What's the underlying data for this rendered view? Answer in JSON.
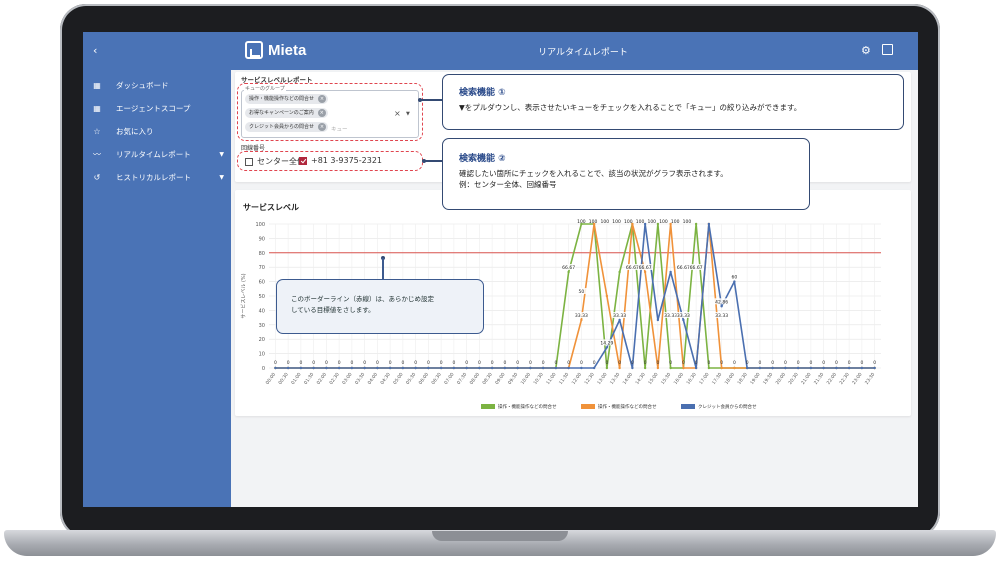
{
  "app": {
    "brand": "Mieta",
    "page_title": "リアルタイムレポート",
    "collapse_glyph": "‹"
  },
  "sidebar": {
    "items": [
      {
        "label": "ダッシュボード",
        "icon": "dashboard-icon",
        "expandable": false
      },
      {
        "label": "エージェントスコープ",
        "icon": "agent-scope-icon",
        "expandable": false
      },
      {
        "label": "お気に入り",
        "icon": "star-icon",
        "expandable": false
      },
      {
        "label": "リアルタイムレポート",
        "icon": "trend-icon",
        "expandable": true
      },
      {
        "label": "ヒストリカルレポート",
        "icon": "history-icon",
        "expandable": true
      }
    ]
  },
  "filter": {
    "section_title": "サービスレベルレポート",
    "queue_label": "キューのグループ",
    "queue_chips": [
      "操作・機能操作などの問合せ",
      "お得なキャンペーンのご案内",
      "クレジット会員からの問合せ"
    ],
    "queue_placeholder": "キュー",
    "line_label": "回線番号",
    "checkboxes": [
      {
        "label": "センター全体",
        "checked": false
      },
      {
        "label": "+81 3-9375-2321",
        "checked": true
      }
    ]
  },
  "callouts": {
    "search1": {
      "title": "検索機能 ①",
      "text": "▼をプルダウンし、表示させたいキューをチェックを入れることで「キュー」の絞り込みができます。"
    },
    "search2": {
      "title": "検索機能 ②",
      "line1": "確認したい箇所にチェックを入れることで、該当の状況がグラフ表示されます。",
      "line2": "例：センター全体、回線番号"
    },
    "border": {
      "line1": "このボーダーライン（赤線）は、あらかじめ設定",
      "line2": "している目標値をさします。"
    }
  },
  "colors": {
    "brand_blue": "#4a73b6",
    "green": "#7cb342",
    "orange": "#f0923a",
    "blue": "#4a6fb0",
    "target_line": "#d9534f"
  },
  "chart_data": {
    "type": "line",
    "title": "サービスレベル",
    "ylabel": "サービスレベル (%)",
    "ylim": [
      0,
      100
    ],
    "yticks": [
      0,
      10,
      20,
      30,
      40,
      50,
      60,
      70,
      80,
      90,
      100
    ],
    "target": 80,
    "grid": true,
    "legend_position": "bottom",
    "x": [
      "00:00",
      "00:30",
      "01:00",
      "01:30",
      "02:00",
      "02:30",
      "03:00",
      "03:30",
      "04:00",
      "04:30",
      "05:00",
      "05:30",
      "06:00",
      "06:30",
      "07:00",
      "07:30",
      "08:00",
      "08:30",
      "09:00",
      "09:30",
      "10:00",
      "10:30",
      "11:00",
      "11:30",
      "12:00",
      "12:30",
      "13:00",
      "13:30",
      "14:00",
      "14:30",
      "15:00",
      "15:30",
      "16:00",
      "16:30",
      "17:00",
      "17:30",
      "18:00",
      "18:30",
      "19:00",
      "19:30",
      "20:00",
      "20:30",
      "21:00",
      "21:30",
      "22:00",
      "22:30",
      "23:00",
      "23:30"
    ],
    "series": [
      {
        "name": "操作・機能操作などの問合せ",
        "color": "#7cb342",
        "values": [
          0,
          0,
          0,
          0,
          0,
          0,
          0,
          0,
          0,
          0,
          0,
          0,
          0,
          0,
          0,
          0,
          0,
          0,
          0,
          0,
          0,
          0,
          0,
          66.67,
          100,
          100,
          0,
          66.67,
          100,
          0,
          100,
          0,
          0,
          100,
          0,
          0,
          0,
          0,
          0,
          0,
          0,
          0,
          0,
          0,
          0,
          0,
          0,
          0
        ]
      },
      {
        "name": "操作・機能操作などの問合せ",
        "color": "#f0923a",
        "values": [
          0,
          0,
          0,
          0,
          0,
          0,
          0,
          0,
          0,
          0,
          0,
          0,
          0,
          0,
          0,
          0,
          0,
          0,
          0,
          0,
          0,
          0,
          0,
          0,
          33.33,
          100,
          50,
          0,
          100,
          66.67,
          0,
          100,
          0,
          0,
          100,
          0,
          0,
          0,
          0,
          0,
          0,
          0,
          0,
          0,
          0,
          0,
          0,
          0
        ]
      },
      {
        "name": "クレジット会員からの問合せ",
        "color": "#4a6fb0",
        "values": [
          0,
          0,
          0,
          0,
          0,
          0,
          0,
          0,
          0,
          0,
          0,
          0,
          0,
          0,
          0,
          0,
          0,
          0,
          0,
          0,
          0,
          0,
          0,
          0,
          0,
          0,
          14.29,
          33.33,
          0,
          100,
          33.33,
          66.67,
          33.33,
          0,
          100,
          42.86,
          60,
          0,
          0,
          0,
          0,
          0,
          0,
          0,
          0,
          0,
          0,
          0
        ]
      }
    ],
    "data_labels": [
      {
        "x": "11:30",
        "text": "66.67"
      },
      {
        "x": "12:00",
        "text": "50"
      },
      {
        "x": "12:00",
        "text": "33.33"
      },
      {
        "x": "13:00",
        "text": "14.29"
      },
      {
        "x": "13:30",
        "text": "33.33"
      },
      {
        "x": "14:00",
        "text": "66.67"
      },
      {
        "x": "14:30",
        "text": "66.67"
      },
      {
        "x": "15:30",
        "text": "33.33"
      },
      {
        "x": "16:00",
        "text": "66.67"
      },
      {
        "x": "16:00",
        "text": "33.33"
      },
      {
        "x": "16:30",
        "text": "66.67"
      },
      {
        "x": "17:30",
        "text": "42.86"
      },
      {
        "x": "17:30",
        "text": "33.33"
      },
      {
        "x": "18:00",
        "text": "60"
      }
    ],
    "top_labels": [
      "100",
      "100",
      "100",
      "100",
      "100",
      "100",
      "100",
      "100",
      "100",
      "100"
    ]
  }
}
